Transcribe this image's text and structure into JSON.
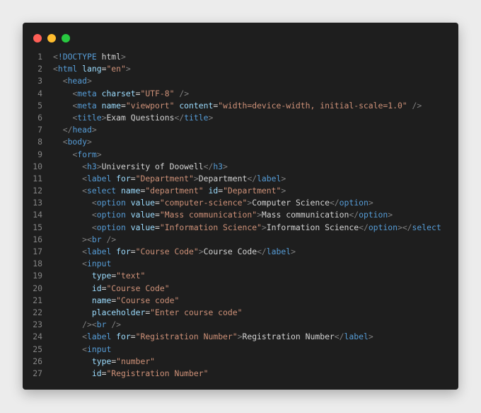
{
  "window": {
    "controls": [
      {
        "name": "close",
        "color": "#ff5f57"
      },
      {
        "name": "minimize",
        "color": "#febc2e"
      },
      {
        "name": "maximize",
        "color": "#28c840"
      }
    ]
  },
  "theme": {
    "background": "#1e1e1e",
    "line_number": "#858585",
    "punctuation": "#808080",
    "tag": "#569cd6",
    "attribute": "#9cdcfe",
    "string": "#ce9178",
    "text": "#d4d4d4"
  },
  "code": {
    "language": "html",
    "lines": [
      {
        "n": "1",
        "tokens": [
          [
            "punct",
            "<"
          ],
          [
            "tag",
            "!DOCTYPE"
          ],
          [
            "txt",
            " html"
          ],
          [
            "punct",
            ">"
          ]
        ]
      },
      {
        "n": "2",
        "tokens": [
          [
            "punct",
            "<"
          ],
          [
            "tag",
            "html"
          ],
          [
            "txt",
            " "
          ],
          [
            "attr",
            "lang"
          ],
          [
            "txt",
            "="
          ],
          [
            "str",
            "\"en\""
          ],
          [
            "punct",
            ">"
          ]
        ]
      },
      {
        "n": "3",
        "tokens": [
          [
            "txt",
            "  "
          ],
          [
            "punct",
            "<"
          ],
          [
            "tag",
            "head"
          ],
          [
            "punct",
            ">"
          ]
        ]
      },
      {
        "n": "4",
        "tokens": [
          [
            "txt",
            "    "
          ],
          [
            "punct",
            "<"
          ],
          [
            "tag",
            "meta"
          ],
          [
            "txt",
            " "
          ],
          [
            "attr",
            "charset"
          ],
          [
            "txt",
            "="
          ],
          [
            "str",
            "\"UTF-8\""
          ],
          [
            "txt",
            " "
          ],
          [
            "punct",
            "/>"
          ]
        ]
      },
      {
        "n": "5",
        "tokens": [
          [
            "txt",
            "    "
          ],
          [
            "punct",
            "<"
          ],
          [
            "tag",
            "meta"
          ],
          [
            "txt",
            " "
          ],
          [
            "attr",
            "name"
          ],
          [
            "txt",
            "="
          ],
          [
            "str",
            "\"viewport\""
          ],
          [
            "txt",
            " "
          ],
          [
            "attr",
            "content"
          ],
          [
            "txt",
            "="
          ],
          [
            "str",
            "\"width=device-width, initial-scale=1.0\""
          ],
          [
            "txt",
            " "
          ],
          [
            "punct",
            "/>"
          ]
        ]
      },
      {
        "n": "6",
        "tokens": [
          [
            "txt",
            "    "
          ],
          [
            "punct",
            "<"
          ],
          [
            "tag",
            "title"
          ],
          [
            "punct",
            ">"
          ],
          [
            "txt",
            "Exam Questions"
          ],
          [
            "punct",
            "</"
          ],
          [
            "tag",
            "title"
          ],
          [
            "punct",
            ">"
          ]
        ]
      },
      {
        "n": "7",
        "tokens": [
          [
            "txt",
            "  "
          ],
          [
            "punct",
            "</"
          ],
          [
            "tag",
            "head"
          ],
          [
            "punct",
            ">"
          ]
        ]
      },
      {
        "n": "8",
        "tokens": [
          [
            "txt",
            "  "
          ],
          [
            "punct",
            "<"
          ],
          [
            "tag",
            "body"
          ],
          [
            "punct",
            ">"
          ]
        ]
      },
      {
        "n": "9",
        "tokens": [
          [
            "txt",
            "    "
          ],
          [
            "punct",
            "<"
          ],
          [
            "tag",
            "form"
          ],
          [
            "punct",
            ">"
          ]
        ]
      },
      {
        "n": "10",
        "tokens": [
          [
            "txt",
            "      "
          ],
          [
            "punct",
            "<"
          ],
          [
            "tag",
            "h3"
          ],
          [
            "punct",
            ">"
          ],
          [
            "txt",
            "University of Doowell"
          ],
          [
            "punct",
            "</"
          ],
          [
            "tag",
            "h3"
          ],
          [
            "punct",
            ">"
          ]
        ]
      },
      {
        "n": "11",
        "tokens": [
          [
            "txt",
            "      "
          ],
          [
            "punct",
            "<"
          ],
          [
            "tag",
            "label"
          ],
          [
            "txt",
            " "
          ],
          [
            "attr",
            "for"
          ],
          [
            "txt",
            "="
          ],
          [
            "str",
            "\"Department\""
          ],
          [
            "punct",
            ">"
          ],
          [
            "txt",
            "Department"
          ],
          [
            "punct",
            "</"
          ],
          [
            "tag",
            "label"
          ],
          [
            "punct",
            ">"
          ]
        ]
      },
      {
        "n": "12",
        "tokens": [
          [
            "txt",
            "      "
          ],
          [
            "punct",
            "<"
          ],
          [
            "tag",
            "select"
          ],
          [
            "txt",
            " "
          ],
          [
            "attr",
            "name"
          ],
          [
            "txt",
            "="
          ],
          [
            "str",
            "\"department\""
          ],
          [
            "txt",
            " "
          ],
          [
            "attr",
            "id"
          ],
          [
            "txt",
            "="
          ],
          [
            "str",
            "\"Department\""
          ],
          [
            "punct",
            ">"
          ]
        ]
      },
      {
        "n": "13",
        "tokens": [
          [
            "txt",
            "        "
          ],
          [
            "punct",
            "<"
          ],
          [
            "tag",
            "option"
          ],
          [
            "txt",
            " "
          ],
          [
            "attr",
            "value"
          ],
          [
            "txt",
            "="
          ],
          [
            "str",
            "\"computer-science\""
          ],
          [
            "punct",
            ">"
          ],
          [
            "txt",
            "Computer Science"
          ],
          [
            "punct",
            "</"
          ],
          [
            "tag",
            "option"
          ],
          [
            "punct",
            ">"
          ]
        ]
      },
      {
        "n": "14",
        "tokens": [
          [
            "txt",
            "        "
          ],
          [
            "punct",
            "<"
          ],
          [
            "tag",
            "option"
          ],
          [
            "txt",
            " "
          ],
          [
            "attr",
            "value"
          ],
          [
            "txt",
            "="
          ],
          [
            "str",
            "\"Mass communication\""
          ],
          [
            "punct",
            ">"
          ],
          [
            "txt",
            "Mass communication"
          ],
          [
            "punct",
            "</"
          ],
          [
            "tag",
            "option"
          ],
          [
            "punct",
            ">"
          ]
        ]
      },
      {
        "n": "15",
        "tokens": [
          [
            "txt",
            "        "
          ],
          [
            "punct",
            "<"
          ],
          [
            "tag",
            "option"
          ],
          [
            "txt",
            " "
          ],
          [
            "attr",
            "value"
          ],
          [
            "txt",
            "="
          ],
          [
            "str",
            "\"Information Science\""
          ],
          [
            "punct",
            ">"
          ],
          [
            "txt",
            "Information Science"
          ],
          [
            "punct",
            "</"
          ],
          [
            "tag",
            "option"
          ],
          [
            "punct",
            "></"
          ],
          [
            "tag",
            "select"
          ]
        ]
      },
      {
        "n": "16",
        "tokens": [
          [
            "txt",
            "      "
          ],
          [
            "punct",
            "><"
          ],
          [
            "tag",
            "br"
          ],
          [
            "txt",
            " "
          ],
          [
            "punct",
            "/>"
          ]
        ]
      },
      {
        "n": "17",
        "tokens": [
          [
            "txt",
            "      "
          ],
          [
            "punct",
            "<"
          ],
          [
            "tag",
            "label"
          ],
          [
            "txt",
            " "
          ],
          [
            "attr",
            "for"
          ],
          [
            "txt",
            "="
          ],
          [
            "str",
            "\"Course Code\""
          ],
          [
            "punct",
            ">"
          ],
          [
            "txt",
            "Course Code"
          ],
          [
            "punct",
            "</"
          ],
          [
            "tag",
            "label"
          ],
          [
            "punct",
            ">"
          ]
        ]
      },
      {
        "n": "18",
        "tokens": [
          [
            "txt",
            "      "
          ],
          [
            "punct",
            "<"
          ],
          [
            "tag",
            "input"
          ]
        ]
      },
      {
        "n": "19",
        "tokens": [
          [
            "txt",
            "        "
          ],
          [
            "attr",
            "type"
          ],
          [
            "txt",
            "="
          ],
          [
            "str",
            "\"text\""
          ]
        ]
      },
      {
        "n": "20",
        "tokens": [
          [
            "txt",
            "        "
          ],
          [
            "attr",
            "id"
          ],
          [
            "txt",
            "="
          ],
          [
            "str",
            "\"Course Code\""
          ]
        ]
      },
      {
        "n": "21",
        "tokens": [
          [
            "txt",
            "        "
          ],
          [
            "attr",
            "name"
          ],
          [
            "txt",
            "="
          ],
          [
            "str",
            "\"Course code\""
          ]
        ]
      },
      {
        "n": "22",
        "tokens": [
          [
            "txt",
            "        "
          ],
          [
            "attr",
            "placeholder"
          ],
          [
            "txt",
            "="
          ],
          [
            "str",
            "\"Enter course code\""
          ]
        ]
      },
      {
        "n": "23",
        "tokens": [
          [
            "txt",
            "      "
          ],
          [
            "punct",
            "/><"
          ],
          [
            "tag",
            "br"
          ],
          [
            "txt",
            " "
          ],
          [
            "punct",
            "/>"
          ]
        ]
      },
      {
        "n": "24",
        "tokens": [
          [
            "txt",
            "      "
          ],
          [
            "punct",
            "<"
          ],
          [
            "tag",
            "label"
          ],
          [
            "txt",
            " "
          ],
          [
            "attr",
            "for"
          ],
          [
            "txt",
            "="
          ],
          [
            "str",
            "\"Registration Number\""
          ],
          [
            "punct",
            ">"
          ],
          [
            "txt",
            "Registration Number"
          ],
          [
            "punct",
            "</"
          ],
          [
            "tag",
            "label"
          ],
          [
            "punct",
            ">"
          ]
        ]
      },
      {
        "n": "25",
        "tokens": [
          [
            "txt",
            "      "
          ],
          [
            "punct",
            "<"
          ],
          [
            "tag",
            "input"
          ]
        ]
      },
      {
        "n": "26",
        "tokens": [
          [
            "txt",
            "        "
          ],
          [
            "attr",
            "type"
          ],
          [
            "txt",
            "="
          ],
          [
            "str",
            "\"number\""
          ]
        ]
      },
      {
        "n": "27",
        "tokens": [
          [
            "txt",
            "        "
          ],
          [
            "attr",
            "id"
          ],
          [
            "txt",
            "="
          ],
          [
            "str",
            "\"Registration Number\""
          ]
        ]
      }
    ]
  }
}
